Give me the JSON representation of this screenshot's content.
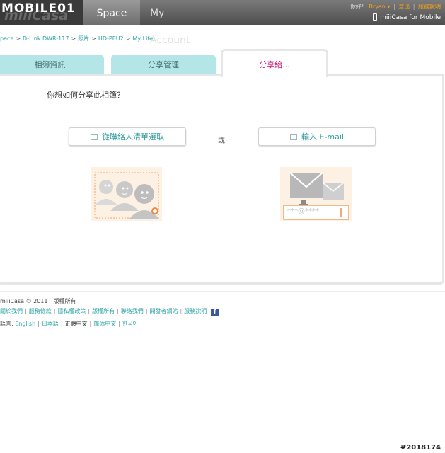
{
  "header": {
    "watermark_logo": "MOBILE01",
    "brand_faint": "miiiCasa",
    "nav_space": "Space",
    "nav_account": "My Account",
    "greeting": "你好！",
    "username": "Bryan",
    "logout": "登出",
    "help": "服務說明",
    "mobile": "miiiCasa for Mobile",
    "accent_color": "#f3a21b"
  },
  "breadcrumb": [
    "pace",
    "D-Link DWR-117",
    "照片",
    "HD-PEU2",
    "My Life"
  ],
  "tabs": [
    {
      "label": "相簿資訊",
      "active": false
    },
    {
      "label": "分享管理",
      "active": false
    },
    {
      "label": "分享給...",
      "active": true
    }
  ],
  "main": {
    "question": "你想如何分享此相簿？",
    "contacts_button": "從聯絡人清單選取",
    "or": "或",
    "email_button": "輸入 E-mail",
    "email_mask": "***@****"
  },
  "footer": {
    "copyright": "miiiCasa © 2011　版權所有",
    "links": [
      "關於我們",
      "服務條款",
      "隱私權政策",
      "版權所有",
      "聯絡我們",
      "開發者網站",
      "服務說明"
    ],
    "lang_prefix": "語言:",
    "languages": [
      "English",
      "日本語",
      "正體中文",
      "简体中文",
      "한국어"
    ],
    "current_language": "正體中文"
  },
  "watermark_id": "#2018174",
  "colors": {
    "teal": "#2aa3a6",
    "tab_bg": "#b4e6e8",
    "active_tab_text": "#c9156c"
  }
}
